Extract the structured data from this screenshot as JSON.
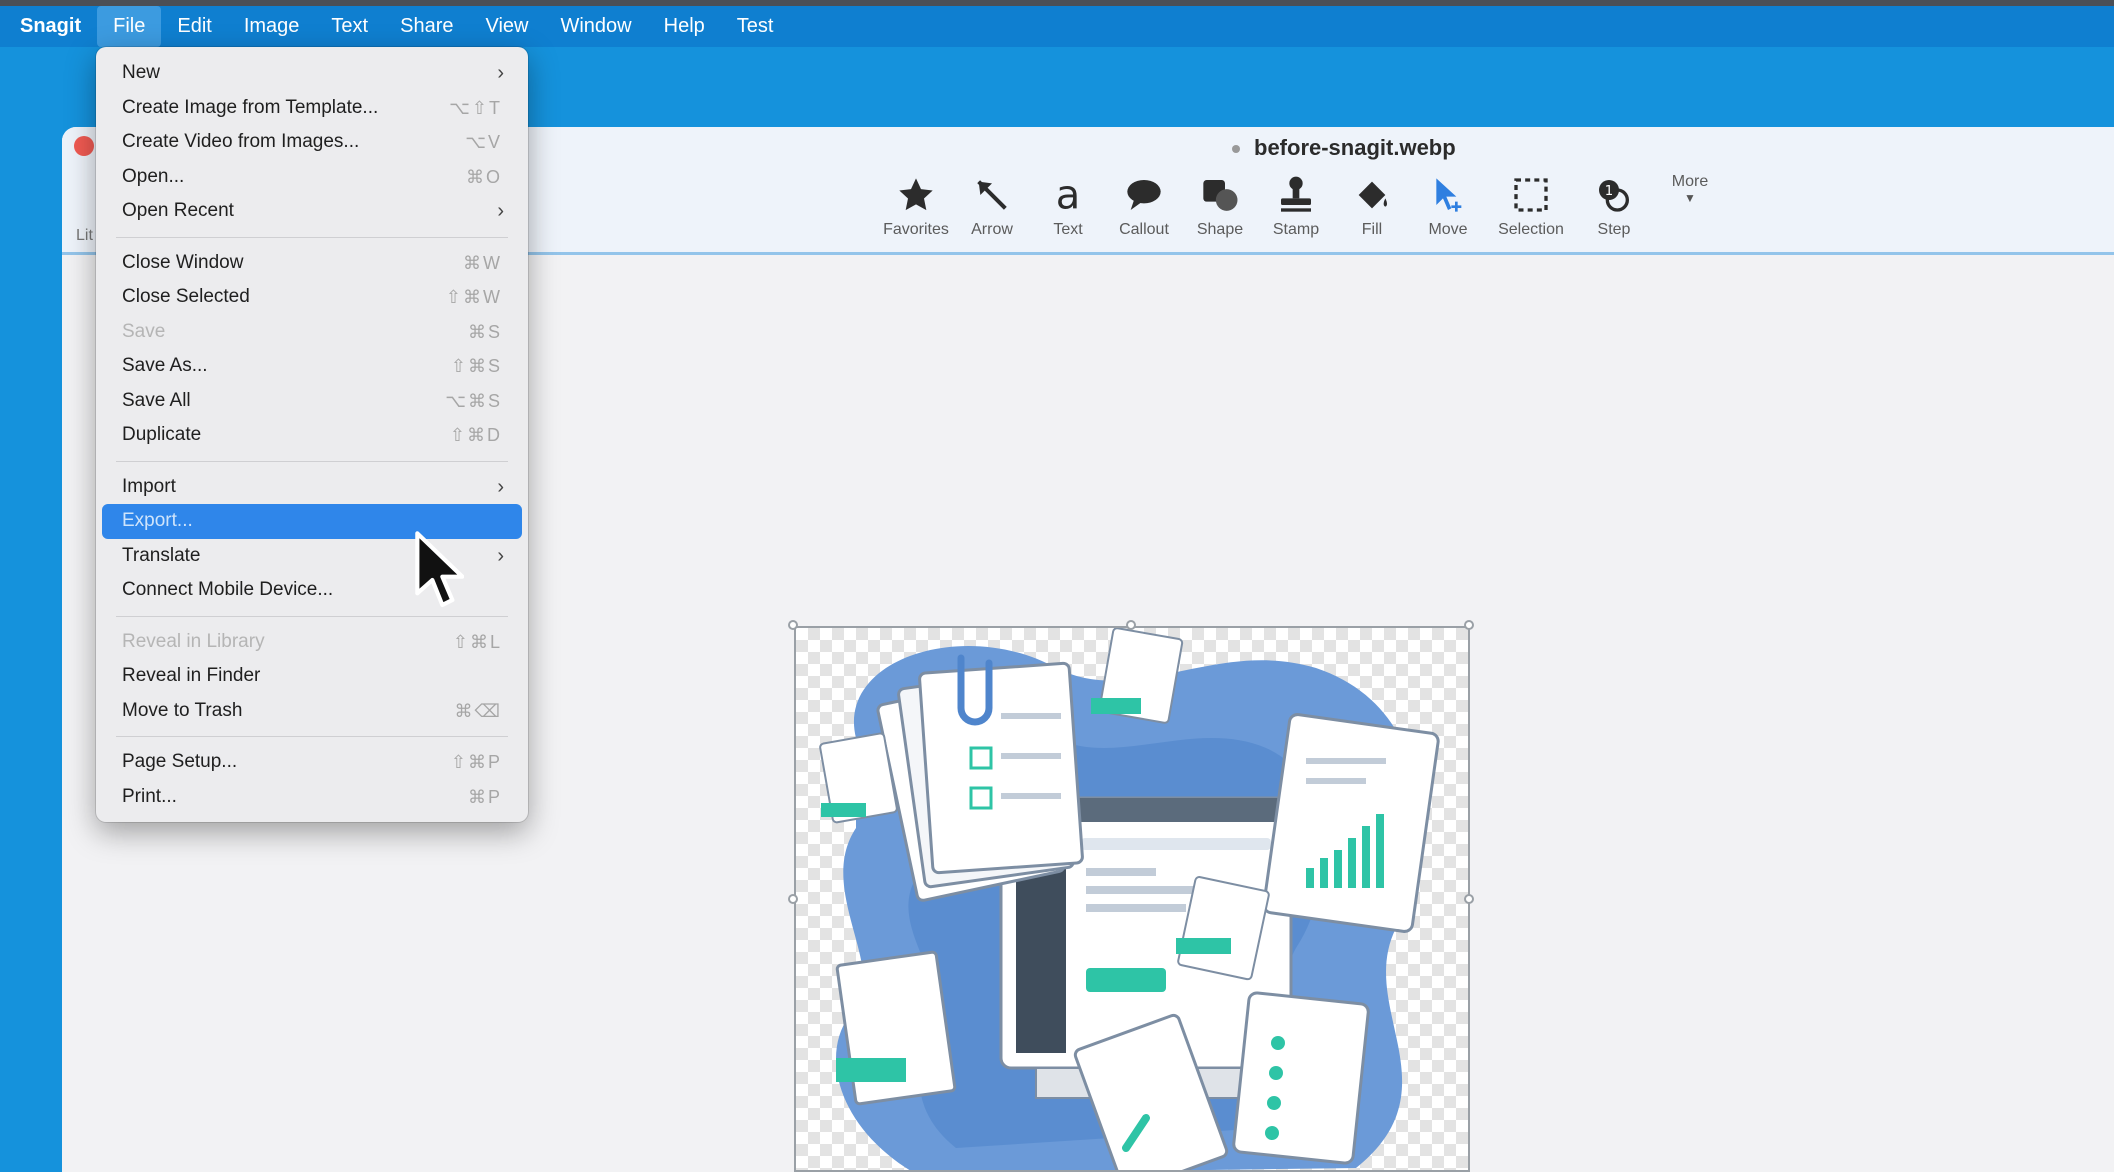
{
  "menubar": {
    "app": "Snagit",
    "items": [
      "File",
      "Edit",
      "Image",
      "Text",
      "Share",
      "View",
      "Window",
      "Help",
      "Test"
    ]
  },
  "window": {
    "doc_title": "before-snagit.webp",
    "library_label": "Lit"
  },
  "toolbar": {
    "tools": [
      {
        "label": "Favorites",
        "icon": "star-icon"
      },
      {
        "label": "Arrow",
        "icon": "arrow-icon"
      },
      {
        "label": "Text",
        "icon": "text-icon"
      },
      {
        "label": "Callout",
        "icon": "callout-icon"
      },
      {
        "label": "Shape",
        "icon": "shape-icon"
      },
      {
        "label": "Stamp",
        "icon": "stamp-icon"
      },
      {
        "label": "Fill",
        "icon": "fill-icon"
      },
      {
        "label": "Move",
        "icon": "move-icon"
      },
      {
        "label": "Selection",
        "icon": "selection-icon"
      },
      {
        "label": "Step",
        "icon": "step-icon"
      }
    ],
    "more_label": "More"
  },
  "file_menu": {
    "groups": [
      [
        {
          "label": "New",
          "submenu": true
        },
        {
          "label": "Create Image from Template...",
          "shortcut": "⌥⇧T"
        },
        {
          "label": "Create Video from Images...",
          "shortcut": "⌥V"
        },
        {
          "label": "Open...",
          "shortcut": "⌘O"
        },
        {
          "label": "Open Recent",
          "submenu": true
        }
      ],
      [
        {
          "label": "Close Window",
          "shortcut": "⌘W"
        },
        {
          "label": "Close Selected",
          "shortcut": "⇧⌘W"
        },
        {
          "label": "Save",
          "shortcut": "⌘S",
          "disabled": true
        },
        {
          "label": "Save As...",
          "shortcut": "⇧⌘S"
        },
        {
          "label": "Save All",
          "shortcut": "⌥⌘S"
        },
        {
          "label": "Duplicate",
          "shortcut": "⇧⌘D"
        }
      ],
      [
        {
          "label": "Import",
          "submenu": true
        },
        {
          "label": "Export...",
          "highlighted": true
        },
        {
          "label": "Translate",
          "submenu": true
        },
        {
          "label": "Connect Mobile Device..."
        }
      ],
      [
        {
          "label": "Reveal in Library",
          "shortcut": "⇧⌘L",
          "disabled": true
        },
        {
          "label": "Reveal in Finder"
        },
        {
          "label": "Move to Trash",
          "shortcut": "⌘⌫"
        }
      ],
      [
        {
          "label": "Page Setup...",
          "shortcut": "⇧⌘P"
        },
        {
          "label": "Print...",
          "shortcut": "⌘P"
        }
      ]
    ]
  },
  "colors": {
    "menubar": "#0f7fd0",
    "desktop": "#1592dc",
    "highlight": "#2f86ea",
    "accent_teal": "#2ec4a6",
    "illustration_blue": "#5b8fd4"
  }
}
